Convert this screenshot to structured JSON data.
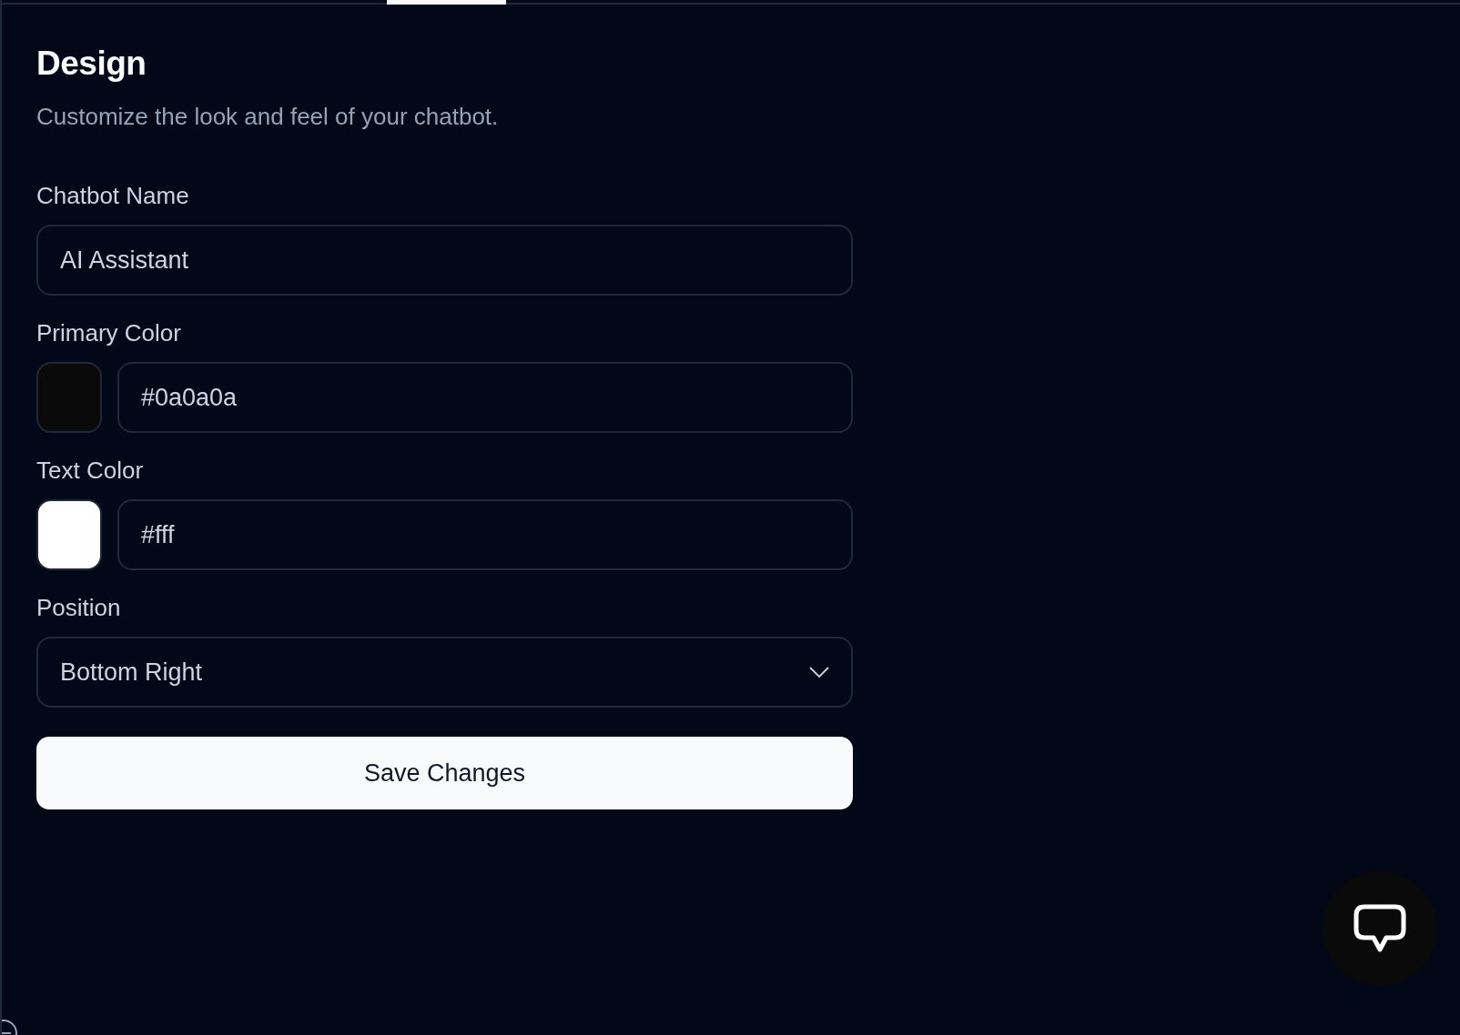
{
  "section": {
    "title": "Design",
    "description": "Customize the look and feel of your chatbot."
  },
  "fields": [
    {
      "kind": "text",
      "label": "Chatbot Name",
      "value": "AI Assistant"
    },
    {
      "kind": "color",
      "label": "Primary Color",
      "value": "#0a0a0a",
      "color": "#0a0a0a"
    },
    {
      "kind": "color",
      "label": "Text Color",
      "value": "#fff",
      "color": "#ffffff"
    },
    {
      "kind": "select",
      "label": "Position",
      "value": "Bottom Right"
    }
  ],
  "save_button": {
    "label": "Save Changes"
  }
}
